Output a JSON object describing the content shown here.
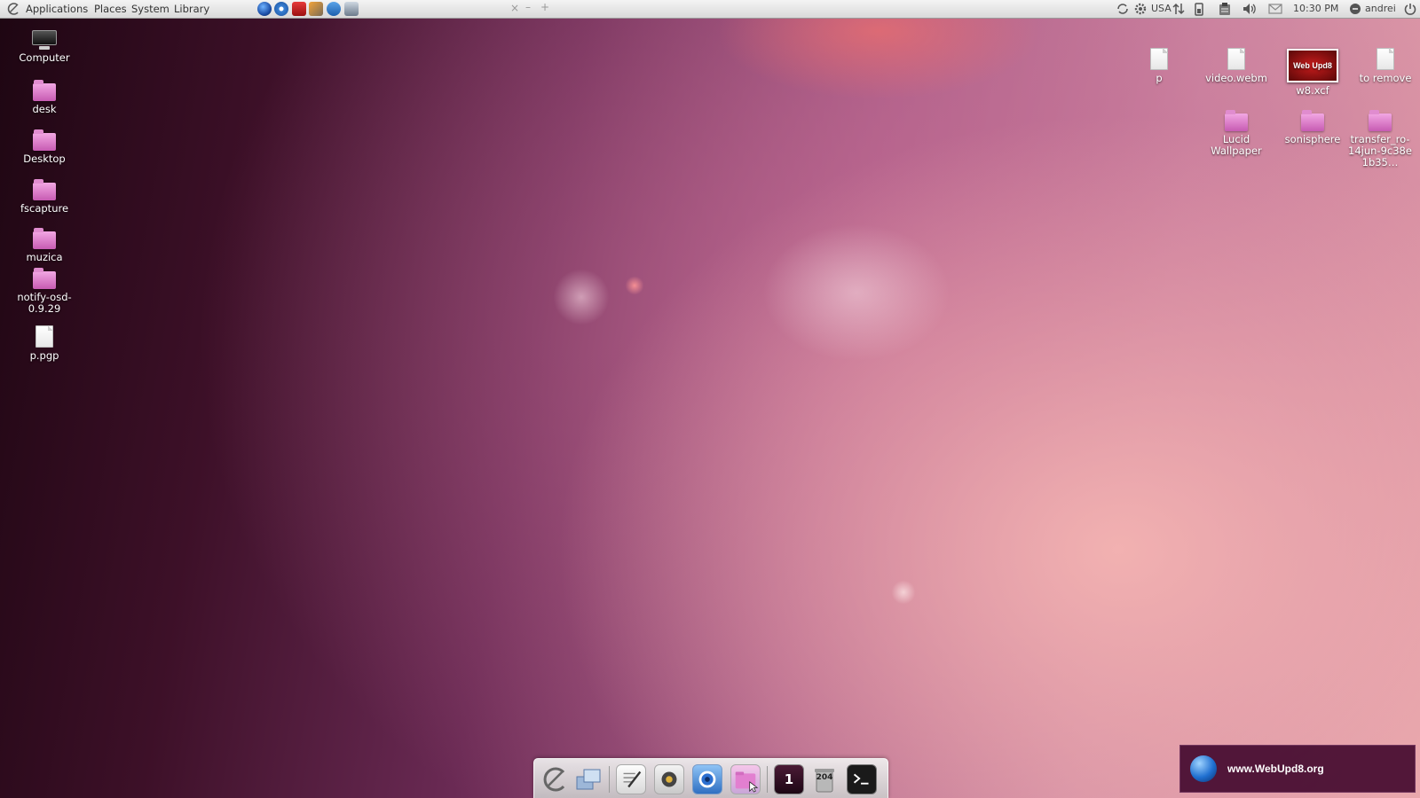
{
  "top_panel": {
    "menus": [
      "Applications",
      "Places",
      "System",
      "Library"
    ],
    "window_controls": {
      "close": "×",
      "minimize": "–",
      "maximize": "+"
    },
    "keyboard_layout": "USA",
    "clock": "10:30 PM",
    "user": "andrei",
    "launchers": [
      "firefox-icon",
      "browser-icon",
      "media-icon",
      "gimp-icon",
      "sync-icon",
      "screen-icon"
    ]
  },
  "desktop_left": [
    {
      "label": "Computer",
      "icon": "computer-icon"
    },
    {
      "label": "desk",
      "icon": "folder-icon"
    },
    {
      "label": "Desktop",
      "icon": "folder-icon"
    },
    {
      "label": "fscapture",
      "icon": "folder-icon"
    },
    {
      "label": "muzica",
      "icon": "folder-icon"
    },
    {
      "label": "notify-osd-0.9.29",
      "icon": "folder-icon"
    },
    {
      "label": "p.pgp",
      "icon": "file-icon"
    }
  ],
  "desktop_right": [
    {
      "label": "p",
      "icon": "file-icon"
    },
    {
      "label": "video.webm",
      "icon": "file-icon"
    },
    {
      "label": "w8.xcf",
      "icon": "image-thumbnail",
      "thumb_text": "Web Upd8"
    },
    {
      "label": "to remove",
      "icon": "file-icon"
    },
    {
      "label": "Lucid Wallpaper",
      "icon": "folder-icon"
    },
    {
      "label": "sonisphere",
      "icon": "folder-icon"
    },
    {
      "label": "transfer_ro-14jun-9c38e1b35…",
      "icon": "folder-icon"
    }
  ],
  "dock": {
    "workspace_number": "1",
    "trash_count": "204",
    "items": [
      "ubuntu-logo-icon",
      "desktop-switch-icon",
      "text-editor-icon",
      "audio-player-icon",
      "browser-icon",
      "files-folder-icon",
      "workspace-switcher-icon",
      "trash-icon",
      "terminal-icon"
    ]
  },
  "notification": {
    "text": "www.WebUpd8.org",
    "icon": "globe-icon"
  },
  "colors": {
    "panel": "#e6e6e6",
    "folder": "#d472c3",
    "notification_bg": "#460c30"
  }
}
